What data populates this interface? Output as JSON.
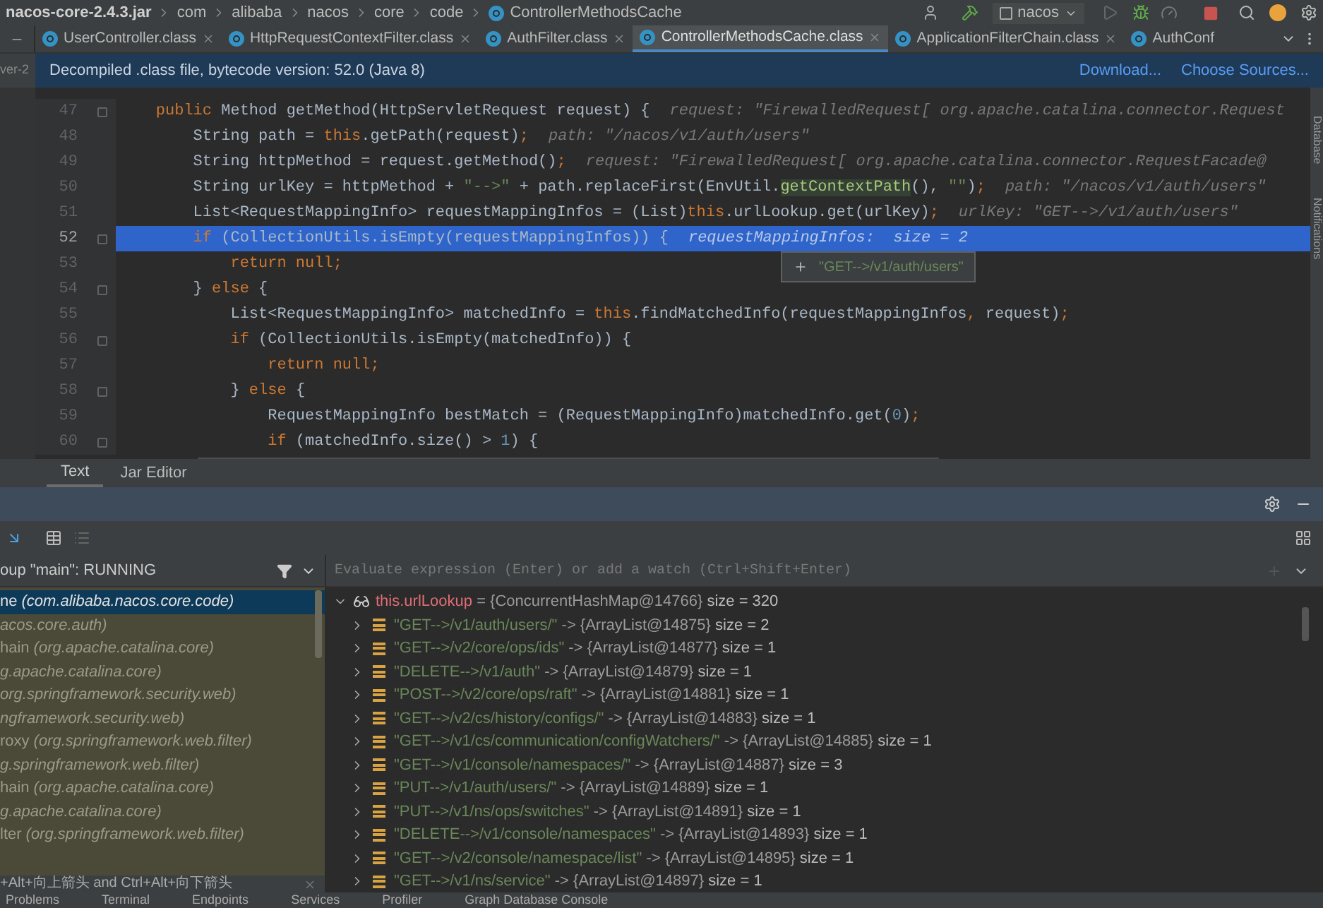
{
  "breadcrumb": [
    {
      "label": "nacos-core-2.4.3.jar",
      "kind": "jar"
    },
    {
      "label": "com",
      "kind": "folder"
    },
    {
      "label": "alibaba",
      "kind": "folder"
    },
    {
      "label": "nacos",
      "kind": "folder"
    },
    {
      "label": "core",
      "kind": "folder"
    },
    {
      "label": "code",
      "kind": "folder"
    },
    {
      "label": "ControllerMethodsCache",
      "kind": "class"
    }
  ],
  "run_config": "nacos",
  "project_stub": "ver-2",
  "tabs": [
    {
      "label": "UserController.class",
      "selected": false,
      "closable": true
    },
    {
      "label": "HttpRequestContextFilter.class",
      "selected": false,
      "closable": true
    },
    {
      "label": "AuthFilter.class",
      "selected": false,
      "closable": true
    },
    {
      "label": "ControllerMethodsCache.class",
      "selected": true,
      "closable": true
    },
    {
      "label": "ApplicationFilterChain.class",
      "selected": false,
      "closable": true
    },
    {
      "label": "AuthConf",
      "selected": false,
      "closable": false
    }
  ],
  "banner": {
    "text": "Decompiled .class file, bytecode version: 52.0 (Java 8)",
    "links": [
      "Download...",
      "Choose Sources..."
    ]
  },
  "code_lines": [
    {
      "number": "47",
      "fold": true,
      "selected": false,
      "tokens": [
        {
          "text": "    public ",
          "kind": "kw"
        },
        {
          "text": "Method getMethod(HttpServletRequest request) {",
          "kind": "plain"
        }
      ],
      "hint": "request: \"FirewalledRequest[ org.apache.catalina.connector.Request"
    },
    {
      "number": "48",
      "fold": false,
      "selected": false,
      "tokens": [
        {
          "text": "        String path = ",
          "kind": "plain"
        },
        {
          "text": "this",
          "kind": "kw"
        },
        {
          "text": ".getPath(request)",
          "kind": "plain"
        },
        {
          "text": ";",
          "kind": "kw"
        }
      ],
      "hint": "path: \"/nacos/v1/auth/users\""
    },
    {
      "number": "49",
      "fold": false,
      "selected": false,
      "tokens": [
        {
          "text": "        String httpMethod = request.getMethod()",
          "kind": "plain"
        },
        {
          "text": ";",
          "kind": "kw"
        }
      ],
      "hint": "request: \"FirewalledRequest[ org.apache.catalina.connector.RequestFacade@"
    },
    {
      "number": "50",
      "fold": false,
      "selected": false,
      "tokens": [
        {
          "text": "        String urlKey = httpMethod + ",
          "kind": "plain"
        },
        {
          "text": "\"-->\"",
          "kind": "str"
        },
        {
          "text": " + path.replaceFirst(EnvUtil.",
          "kind": "plain"
        },
        {
          "text": "getContextPath",
          "kind": "static"
        },
        {
          "text": "(), ",
          "kind": "plain"
        },
        {
          "text": "\"\"",
          "kind": "str"
        },
        {
          "text": ")",
          "kind": "plain"
        },
        {
          "text": ";",
          "kind": "kw"
        }
      ],
      "hint": "path: \"/nacos/v1/auth/users\""
    },
    {
      "number": "51",
      "fold": false,
      "selected": false,
      "tokens": [
        {
          "text": "        List<RequestMappingInfo> requestMappingInfos = (List)",
          "kind": "plain"
        },
        {
          "text": "this",
          "kind": "kw"
        },
        {
          "text": ".urlLookup.get(urlKey)",
          "kind": "plain"
        },
        {
          "text": ";",
          "kind": "kw"
        }
      ],
      "hint": "urlKey: \"GET-->/v1/auth/users\""
    },
    {
      "number": "52",
      "fold": true,
      "selected": true,
      "tokens": [
        {
          "text": "        if ",
          "kind": "kw"
        },
        {
          "text": "(CollectionUtils.isEmpty(requestMappingInfos)) {",
          "kind": "plain"
        }
      ],
      "hint": "requestMappingInfos:  size = 2"
    },
    {
      "number": "53",
      "fold": false,
      "selected": false,
      "tokens": [
        {
          "text": "            return null;",
          "kind": "kw"
        }
      ]
    },
    {
      "number": "54",
      "fold": true,
      "selected": false,
      "tokens": [
        {
          "text": "        } ",
          "kind": "plain"
        },
        {
          "text": "else ",
          "kind": "kw"
        },
        {
          "text": "{",
          "kind": "plain"
        }
      ]
    },
    {
      "number": "55",
      "fold": false,
      "selected": false,
      "tokens": [
        {
          "text": "            List<RequestMappingInfo> matchedInfo = ",
          "kind": "plain"
        },
        {
          "text": "this",
          "kind": "kw"
        },
        {
          "text": ".findMatchedInfo(requestMappingInfos",
          "kind": "plain"
        },
        {
          "text": ", ",
          "kind": "kw"
        },
        {
          "text": "request)",
          "kind": "plain"
        },
        {
          "text": ";",
          "kind": "kw"
        }
      ]
    },
    {
      "number": "56",
      "fold": true,
      "selected": false,
      "tokens": [
        {
          "text": "            if ",
          "kind": "kw"
        },
        {
          "text": "(CollectionUtils.isEmpty(matchedInfo)) {",
          "kind": "plain"
        }
      ]
    },
    {
      "number": "57",
      "fold": false,
      "selected": false,
      "tokens": [
        {
          "text": "                return null;",
          "kind": "kw"
        }
      ]
    },
    {
      "number": "58",
      "fold": true,
      "selected": false,
      "tokens": [
        {
          "text": "            } ",
          "kind": "plain"
        },
        {
          "text": "else ",
          "kind": "kw"
        },
        {
          "text": "{",
          "kind": "plain"
        }
      ]
    },
    {
      "number": "59",
      "fold": false,
      "selected": false,
      "tokens": [
        {
          "text": "                RequestMappingInfo bestMatch = (RequestMappingInfo)matchedInfo.get(",
          "kind": "plain"
        },
        {
          "text": "0",
          "kind": "num"
        },
        {
          "text": ")",
          "kind": "plain"
        },
        {
          "text": ";",
          "kind": "kw"
        }
      ]
    },
    {
      "number": "60",
      "fold": true,
      "selected": false,
      "tokens": [
        {
          "text": "                if ",
          "kind": "kw"
        },
        {
          "text": "(matchedInfo.size() > ",
          "kind": "plain"
        },
        {
          "text": "1",
          "kind": "num"
        },
        {
          "text": ") {",
          "kind": "plain"
        }
      ]
    }
  ],
  "value_popup": "\"GET-->/v1/auth/users\"",
  "side_labels": [
    "Database",
    "Notifications"
  ],
  "editor_tabs": [
    {
      "label": "Text",
      "selected": true
    },
    {
      "label": "Jar Editor",
      "selected": false
    }
  ],
  "frames_header": "oup \"main\": RUNNING",
  "evaluate_placeholder": "Evaluate expression (Enter) or add a watch (Ctrl+Shift+Enter)",
  "frames": [
    {
      "method": "ne",
      "class": "(com.alibaba.nacos.core.code)",
      "selected": true
    },
    {
      "class": "acos.core.auth)",
      "selected": false
    },
    {
      "method": "hain",
      "class": "(org.apache.catalina.core)",
      "selected": false
    },
    {
      "class": "g.apache.catalina.core)",
      "selected": false
    },
    {
      "class": "org.springframework.security.web)",
      "selected": false
    },
    {
      "class": "ngframework.security.web)",
      "selected": false
    },
    {
      "method": "roxy",
      "class": "(org.springframework.web.filter)",
      "selected": false
    },
    {
      "class": "g.springframework.web.filter)",
      "selected": false
    },
    {
      "method": "hain",
      "class": "(org.apache.catalina.core)",
      "selected": false
    },
    {
      "class": "g.apache.catalina.core)",
      "selected": false
    },
    {
      "method": "lter",
      "class": "(org.springframework.web.filter)",
      "selected": false
    }
  ],
  "variable": {
    "name": "this.urlLookup",
    "value": "= {ConcurrentHashMap@14766}",
    "size": "size = 320",
    "expanded": true,
    "children": [
      {
        "key": "\"GET-->/v1/auth/users/\"",
        "value": "-> {ArrayList@14875}",
        "size": "size = 2"
      },
      {
        "key": "\"GET-->/v2/core/ops/ids\"",
        "value": "-> {ArrayList@14877}",
        "size": "size = 1"
      },
      {
        "key": "\"DELETE-->/v1/auth\"",
        "value": "-> {ArrayList@14879}",
        "size": "size = 1"
      },
      {
        "key": "\"POST-->/v2/core/ops/raft\"",
        "value": "-> {ArrayList@14881}",
        "size": "size = 1"
      },
      {
        "key": "\"GET-->/v2/cs/history/configs/\"",
        "value": "-> {ArrayList@14883}",
        "size": "size = 1"
      },
      {
        "key": "\"GET-->/v1/cs/communication/configWatchers/\"",
        "value": "-> {ArrayList@14885}",
        "size": "size = 1"
      },
      {
        "key": "\"GET-->/v1/console/namespaces/\"",
        "value": "-> {ArrayList@14887}",
        "size": "size = 3"
      },
      {
        "key": "\"PUT-->/v1/auth/users/\"",
        "value": "-> {ArrayList@14889}",
        "size": "size = 1"
      },
      {
        "key": "\"PUT-->/v1/ns/ops/switches\"",
        "value": "-> {ArrayList@14891}",
        "size": "size = 1"
      },
      {
        "key": "\"DELETE-->/v1/console/namespaces\"",
        "value": "-> {ArrayList@14893}",
        "size": "size = 1"
      },
      {
        "key": "\"GET-->/v2/console/namespace/list\"",
        "value": "-> {ArrayList@14895}",
        "size": "size = 1"
      },
      {
        "key": "\"GET-->/v1/ns/service\"",
        "value": "-> {ArrayList@14897}",
        "size": "size = 1"
      }
    ]
  },
  "hint_bar": "+Alt+向上箭头 and Ctrl+Alt+向下箭头",
  "tool_windows": [
    "Problems",
    "Terminal",
    "Endpoints",
    "Services",
    "Profiler",
    "Graph Database Console"
  ]
}
